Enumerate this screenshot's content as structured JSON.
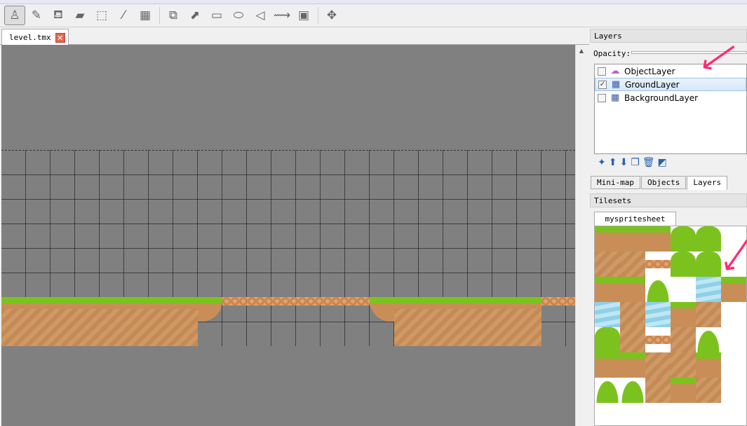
{
  "toolbar": {
    "tools": [
      {
        "name": "stamp-brush-icon",
        "glyph": "♙",
        "active": true
      },
      {
        "name": "terrain-brush-icon",
        "glyph": "✎"
      },
      {
        "name": "bucket-fill-icon",
        "glyph": "⛾"
      },
      {
        "name": "eraser-icon",
        "glyph": "▰"
      },
      {
        "name": "rectangle-select-icon",
        "glyph": "⬚"
      },
      {
        "name": "magic-wand-icon",
        "glyph": "⁄"
      },
      {
        "name": "select-same-tile-icon",
        "glyph": "▦"
      },
      {
        "sep": true
      },
      {
        "name": "select-objects-icon",
        "glyph": "⧉"
      },
      {
        "name": "edit-polygons-icon",
        "glyph": "⬈"
      },
      {
        "name": "insert-rectangle-icon",
        "glyph": "▭"
      },
      {
        "name": "insert-ellipse-icon",
        "glyph": "⬭"
      },
      {
        "name": "insert-polygon-icon",
        "glyph": "◁"
      },
      {
        "name": "insert-polyline-icon",
        "glyph": "⟿"
      },
      {
        "name": "insert-tile-icon",
        "glyph": "▣"
      },
      {
        "sep": true
      },
      {
        "name": "move-icon",
        "glyph": "✥"
      }
    ]
  },
  "document": {
    "tab_label": "level.tmx",
    "close_glyph": "✕"
  },
  "layers_panel": {
    "title": "Layers",
    "opacity_label": "Opacity:",
    "layers": [
      {
        "name": "ObjectLayer",
        "visible": false,
        "icon": "object-layer-icon",
        "glyph": "☁",
        "color": "#c060d0"
      },
      {
        "name": "GroundLayer",
        "visible": true,
        "selected": true,
        "icon": "tile-layer-icon",
        "glyph": "▦",
        "color": "#3a5aa0"
      },
      {
        "name": "BackgroundLayer",
        "visible": false,
        "icon": "tile-layer-icon",
        "glyph": "▦",
        "color": "#3a5aa0"
      }
    ],
    "buttons": [
      {
        "name": "new-layer-icon",
        "glyph": "✦"
      },
      {
        "name": "move-up-icon",
        "glyph": "⬆"
      },
      {
        "name": "move-down-icon",
        "glyph": "⬇"
      },
      {
        "name": "duplicate-layer-icon",
        "glyph": "❐"
      },
      {
        "name": "delete-layer-icon",
        "glyph": "🗑"
      },
      {
        "name": "layer-properties-icon",
        "glyph": "◩"
      }
    ]
  },
  "panel_tabs": [
    "Mini-map",
    "Objects",
    "Layers"
  ],
  "tilesets_panel": {
    "title": "Tilesets",
    "tab_label": "myspritesheet"
  },
  "colors": {
    "grass": "#7cc21e",
    "dirt": "#c98e57",
    "canvas": "#808080",
    "arrow": "#ff2d6f"
  }
}
